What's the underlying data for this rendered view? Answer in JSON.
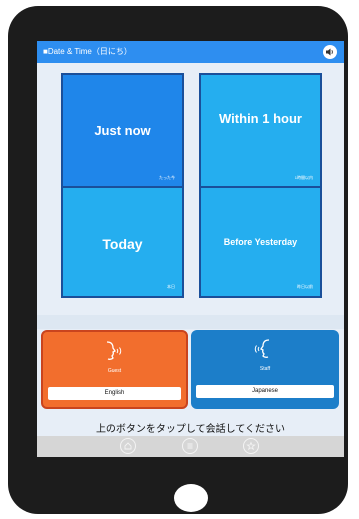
{
  "screen": {
    "title": "■Date & Time（日にち）",
    "tiles": [
      {
        "label": "Just now",
        "sub": "たった今"
      },
      {
        "label": "Within 1 hour",
        "sub": "1時間以内"
      },
      {
        "label": "Today",
        "sub": "本日"
      },
      {
        "label": "Before Yesterday",
        "sub": "昨日以前"
      }
    ],
    "guest": {
      "role": "Guest",
      "language": "English"
    },
    "staff": {
      "role": "Staff",
      "language": "Japanese"
    },
    "hint": "上のボタンをタップして会話してください"
  },
  "colors": {
    "title_bar": "#2e8ef0",
    "tile_selected": "#1f86ea",
    "tile": "#25aeef",
    "guest": "#f26e2d",
    "staff": "#1c7ec9"
  },
  "icons": {
    "speaker": "speaker-icon",
    "nav": [
      "home-icon",
      "menu-icon",
      "star-icon"
    ]
  }
}
